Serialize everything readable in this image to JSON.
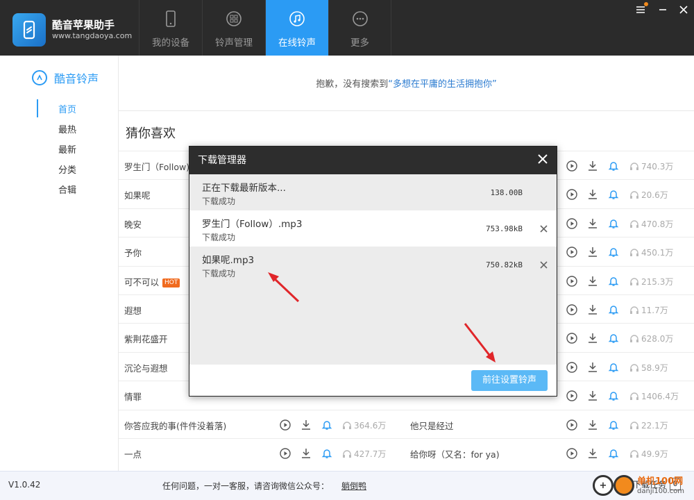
{
  "app": {
    "name": "酷音苹果助手",
    "url": "www.tangdaoya.com"
  },
  "tabs": [
    {
      "label": "我的设备",
      "icon": "phone-icon"
    },
    {
      "label": "铃声管理",
      "icon": "grid-icon"
    },
    {
      "label": "在线铃声",
      "icon": "music-note-icon",
      "active": true
    },
    {
      "label": "更多",
      "icon": "more-dots-icon"
    }
  ],
  "sidebar": {
    "title": "酷音铃声",
    "items": [
      {
        "label": "首页"
      },
      {
        "label": "最热"
      },
      {
        "label": "最新"
      },
      {
        "label": "分类"
      },
      {
        "label": "合辑"
      }
    ]
  },
  "notice": {
    "prefix": "抱歉，没有搜索到",
    "query": "“多想在平庸的生活拥抱你”"
  },
  "section_title": "猜你喜欢",
  "songs_left": [
    {
      "name": "罗生门（Follow)"
    },
    {
      "name": "如果呢"
    },
    {
      "name": "晚安"
    },
    {
      "name": "予你"
    },
    {
      "name": "可不可以",
      "hot": "HOT"
    },
    {
      "name": "遐想"
    },
    {
      "name": "紫荆花盛开"
    },
    {
      "name": "沉沦与遐想"
    },
    {
      "name": "情罪"
    },
    {
      "name": "你答应我的事(件件没着落)",
      "count": "364.6万"
    },
    {
      "name": "一点",
      "count": "427.7万"
    }
  ],
  "songs_right": [
    {
      "count": "740.3万"
    },
    {
      "count": "20.6万"
    },
    {
      "count": "470.8万"
    },
    {
      "count": "450.1万"
    },
    {
      "count": "215.3万"
    },
    {
      "count": "11.7万"
    },
    {
      "count": "628.0万"
    },
    {
      "count": "58.9万"
    },
    {
      "count": "1406.4万"
    },
    {
      "name": "他只是经过",
      "count": "22.1万"
    },
    {
      "name": "给你呀（又名：for ya)",
      "count": "49.9万"
    }
  ],
  "modal": {
    "title": "下载管理器",
    "items": [
      {
        "name": "正在下载最新版本...",
        "status": "下载成功",
        "size": "138.00B"
      },
      {
        "name": "罗生门（Follow）.mp3",
        "status": "下载成功",
        "size": "753.98kB"
      },
      {
        "name": "如果呢.mp3",
        "status": "下载成功",
        "size": "750.82kB"
      }
    ],
    "button": "前往设置铃声"
  },
  "status": {
    "version": "V1.0.42",
    "support": "任何问题，一对一客服，请咨询微信公众号：",
    "wechat": "躺倒鸭",
    "dl_task": "下载任务",
    "dl_count": "0"
  },
  "watermark": {
    "text": "单机100网",
    "url": "danji100.com"
  },
  "colors": {
    "accent": "#2b9bf4",
    "topbar": "#2b2b2b",
    "button": "#5bb9f6",
    "hot": "#f06a1e",
    "arrow": "#e0262a"
  }
}
